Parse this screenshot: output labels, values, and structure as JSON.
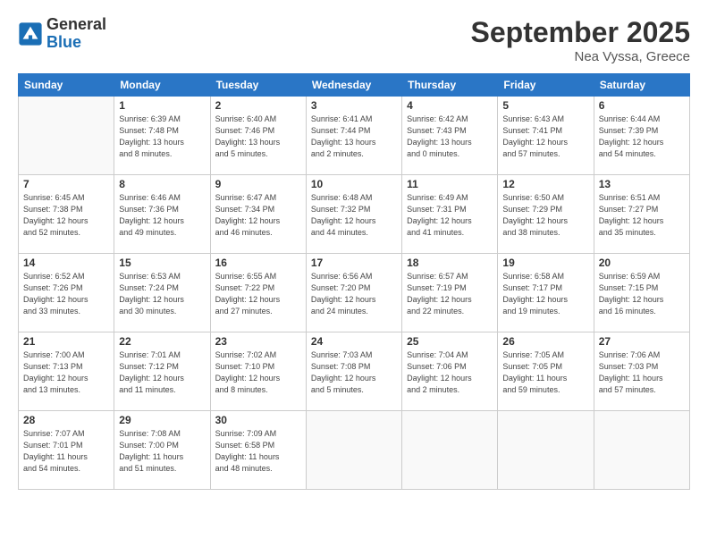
{
  "header": {
    "logo_general": "General",
    "logo_blue": "Blue",
    "title": "September 2025",
    "subtitle": "Nea Vyssa, Greece"
  },
  "days_of_week": [
    "Sunday",
    "Monday",
    "Tuesday",
    "Wednesday",
    "Thursday",
    "Friday",
    "Saturday"
  ],
  "weeks": [
    [
      {
        "day": "",
        "info": ""
      },
      {
        "day": "1",
        "info": "Sunrise: 6:39 AM\nSunset: 7:48 PM\nDaylight: 13 hours\nand 8 minutes."
      },
      {
        "day": "2",
        "info": "Sunrise: 6:40 AM\nSunset: 7:46 PM\nDaylight: 13 hours\nand 5 minutes."
      },
      {
        "day": "3",
        "info": "Sunrise: 6:41 AM\nSunset: 7:44 PM\nDaylight: 13 hours\nand 2 minutes."
      },
      {
        "day": "4",
        "info": "Sunrise: 6:42 AM\nSunset: 7:43 PM\nDaylight: 13 hours\nand 0 minutes."
      },
      {
        "day": "5",
        "info": "Sunrise: 6:43 AM\nSunset: 7:41 PM\nDaylight: 12 hours\nand 57 minutes."
      },
      {
        "day": "6",
        "info": "Sunrise: 6:44 AM\nSunset: 7:39 PM\nDaylight: 12 hours\nand 54 minutes."
      }
    ],
    [
      {
        "day": "7",
        "info": "Sunrise: 6:45 AM\nSunset: 7:38 PM\nDaylight: 12 hours\nand 52 minutes."
      },
      {
        "day": "8",
        "info": "Sunrise: 6:46 AM\nSunset: 7:36 PM\nDaylight: 12 hours\nand 49 minutes."
      },
      {
        "day": "9",
        "info": "Sunrise: 6:47 AM\nSunset: 7:34 PM\nDaylight: 12 hours\nand 46 minutes."
      },
      {
        "day": "10",
        "info": "Sunrise: 6:48 AM\nSunset: 7:32 PM\nDaylight: 12 hours\nand 44 minutes."
      },
      {
        "day": "11",
        "info": "Sunrise: 6:49 AM\nSunset: 7:31 PM\nDaylight: 12 hours\nand 41 minutes."
      },
      {
        "day": "12",
        "info": "Sunrise: 6:50 AM\nSunset: 7:29 PM\nDaylight: 12 hours\nand 38 minutes."
      },
      {
        "day": "13",
        "info": "Sunrise: 6:51 AM\nSunset: 7:27 PM\nDaylight: 12 hours\nand 35 minutes."
      }
    ],
    [
      {
        "day": "14",
        "info": "Sunrise: 6:52 AM\nSunset: 7:26 PM\nDaylight: 12 hours\nand 33 minutes."
      },
      {
        "day": "15",
        "info": "Sunrise: 6:53 AM\nSunset: 7:24 PM\nDaylight: 12 hours\nand 30 minutes."
      },
      {
        "day": "16",
        "info": "Sunrise: 6:55 AM\nSunset: 7:22 PM\nDaylight: 12 hours\nand 27 minutes."
      },
      {
        "day": "17",
        "info": "Sunrise: 6:56 AM\nSunset: 7:20 PM\nDaylight: 12 hours\nand 24 minutes."
      },
      {
        "day": "18",
        "info": "Sunrise: 6:57 AM\nSunset: 7:19 PM\nDaylight: 12 hours\nand 22 minutes."
      },
      {
        "day": "19",
        "info": "Sunrise: 6:58 AM\nSunset: 7:17 PM\nDaylight: 12 hours\nand 19 minutes."
      },
      {
        "day": "20",
        "info": "Sunrise: 6:59 AM\nSunset: 7:15 PM\nDaylight: 12 hours\nand 16 minutes."
      }
    ],
    [
      {
        "day": "21",
        "info": "Sunrise: 7:00 AM\nSunset: 7:13 PM\nDaylight: 12 hours\nand 13 minutes."
      },
      {
        "day": "22",
        "info": "Sunrise: 7:01 AM\nSunset: 7:12 PM\nDaylight: 12 hours\nand 11 minutes."
      },
      {
        "day": "23",
        "info": "Sunrise: 7:02 AM\nSunset: 7:10 PM\nDaylight: 12 hours\nand 8 minutes."
      },
      {
        "day": "24",
        "info": "Sunrise: 7:03 AM\nSunset: 7:08 PM\nDaylight: 12 hours\nand 5 minutes."
      },
      {
        "day": "25",
        "info": "Sunrise: 7:04 AM\nSunset: 7:06 PM\nDaylight: 12 hours\nand 2 minutes."
      },
      {
        "day": "26",
        "info": "Sunrise: 7:05 AM\nSunset: 7:05 PM\nDaylight: 11 hours\nand 59 minutes."
      },
      {
        "day": "27",
        "info": "Sunrise: 7:06 AM\nSunset: 7:03 PM\nDaylight: 11 hours\nand 57 minutes."
      }
    ],
    [
      {
        "day": "28",
        "info": "Sunrise: 7:07 AM\nSunset: 7:01 PM\nDaylight: 11 hours\nand 54 minutes."
      },
      {
        "day": "29",
        "info": "Sunrise: 7:08 AM\nSunset: 7:00 PM\nDaylight: 11 hours\nand 51 minutes."
      },
      {
        "day": "30",
        "info": "Sunrise: 7:09 AM\nSunset: 6:58 PM\nDaylight: 11 hours\nand 48 minutes."
      },
      {
        "day": "",
        "info": ""
      },
      {
        "day": "",
        "info": ""
      },
      {
        "day": "",
        "info": ""
      },
      {
        "day": "",
        "info": ""
      }
    ]
  ]
}
